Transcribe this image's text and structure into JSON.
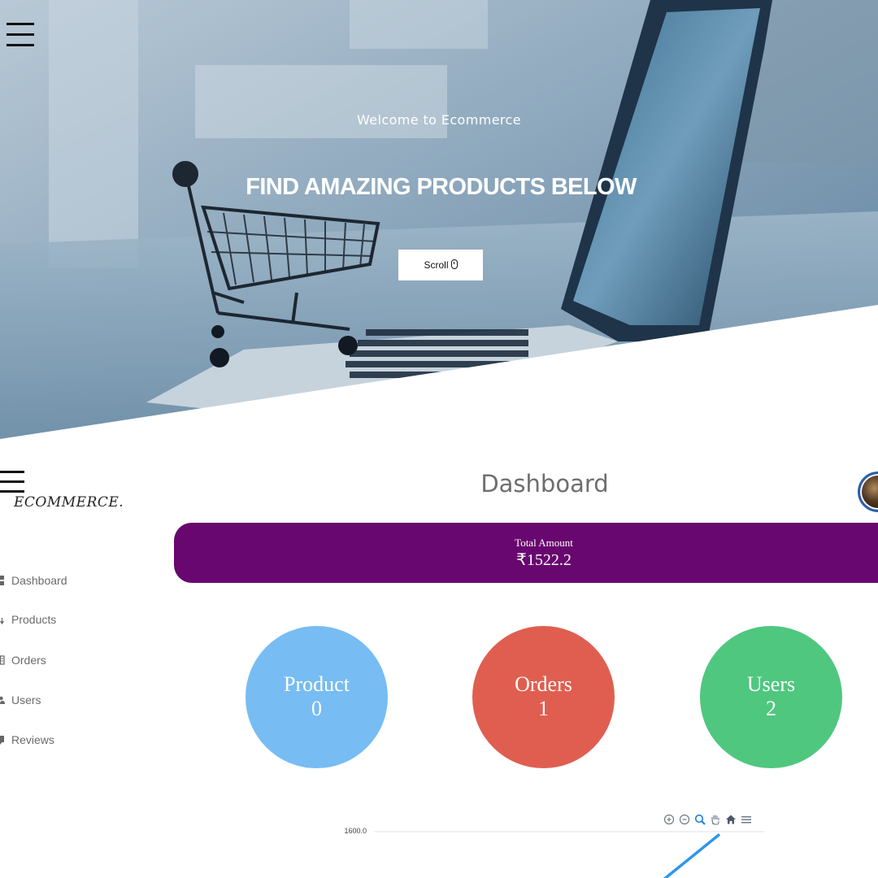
{
  "hero": {
    "welcome": "Welcome to Ecommerce",
    "title": "FIND AMAZING PRODUCTS BELOW",
    "scroll_label": "Scroll"
  },
  "sidebar": {
    "brand": "ECOMMERCE.",
    "items": [
      {
        "label": "Dashboard",
        "icon": "dashboard-icon"
      },
      {
        "label": "Products",
        "icon": "arrow-down-icon"
      },
      {
        "label": "Orders",
        "icon": "orders-icon"
      },
      {
        "label": "Users",
        "icon": "user-icon"
      },
      {
        "label": "Reviews",
        "icon": "reviews-icon"
      }
    ]
  },
  "main": {
    "title": "Dashboard",
    "total_label": "Total Amount",
    "total_value": "₹1522.2",
    "stats": [
      {
        "label": "Product",
        "value": "0",
        "color": "#77bcf2"
      },
      {
        "label": "Orders",
        "value": "1",
        "color": "#e05e50"
      },
      {
        "label": "Users",
        "value": "2",
        "color": "#4fc77f"
      }
    ]
  },
  "colors": {
    "total_bar": "#68076f",
    "chart_line": "#2b96ec"
  },
  "chart_toolbar": [
    "zoom-in-icon",
    "zoom-out-icon",
    "zoom-select-icon",
    "pan-hand-icon",
    "home-icon",
    "menu-icon"
  ],
  "chart_data": {
    "type": "line",
    "title": "",
    "xlabel": "",
    "ylabel": "",
    "yticks": [
      "1600.0"
    ],
    "ylim": [
      0,
      1600
    ],
    "series": [
      {
        "values": [
          0,
          1522.2
        ]
      }
    ],
    "grid": true
  }
}
